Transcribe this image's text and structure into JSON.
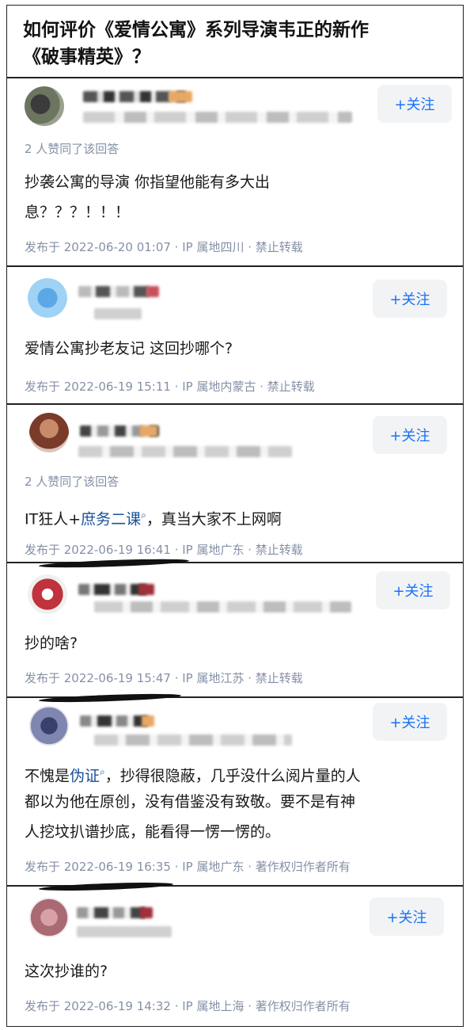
{
  "question": {
    "title_line1": "如何评价《爱情公寓》系列导演韦正的新作",
    "title_line2": "《破事精英》？"
  },
  "answers": [
    {
      "follow_label": "+关注",
      "likes": "2 人赞同了该回答",
      "content_line1": "抄袭公寓的导演 你指望他能有多大出",
      "content_line2": "息？？？！！！",
      "meta": "发布于 2022-06-20 01:07 · IP 属地四川 · 禁止转载"
    },
    {
      "follow_label": "+关注",
      "content_line1": "爱情公寓抄老友记 这回抄哪个?",
      "meta": "发布于 2022-06-19 15:11 · IP 属地内蒙古 · 禁止转载"
    },
    {
      "follow_label": "+关注",
      "likes": "2 人赞同了该回答",
      "content_pre": "IT狂人+",
      "content_link": "庶务二课",
      "content_post": "，真当大家不上网啊",
      "meta": "发布于 2022-06-19 16:41 · IP 属地广东 · 禁止转载"
    },
    {
      "follow_label": "+关注",
      "content_line1": "抄的啥?",
      "meta": "发布于 2022-06-19 15:47 · IP 属地江苏 · 禁止转载"
    },
    {
      "follow_label": "+关注",
      "content_pre": "不愧是",
      "content_link": "伪证",
      "content_post": "，抄得很隐蔽，几乎没什么阅片量的人",
      "content_line2": "都以为他在原创，没有借鉴没有致敬。要不是有神",
      "content_line3": "人挖坟扒谱抄底，能看得一愣一愣的。",
      "meta": "发布于 2022-06-19 16:35 · IP 属地广东 · 著作权归作者所有"
    },
    {
      "follow_label": "+关注",
      "content_line1": "这次抄谁的?",
      "meta": "发布于 2022-06-19 14:32 · IP 属地上海 · 著作权归作者所有"
    }
  ],
  "colors": {
    "follow_text": "#1772f6",
    "follow_bg": "#f2f3f5",
    "meta_gray": "#8590a6",
    "link_blue": "#175199"
  },
  "icons": {
    "search_mark": "magnifier-icon"
  }
}
